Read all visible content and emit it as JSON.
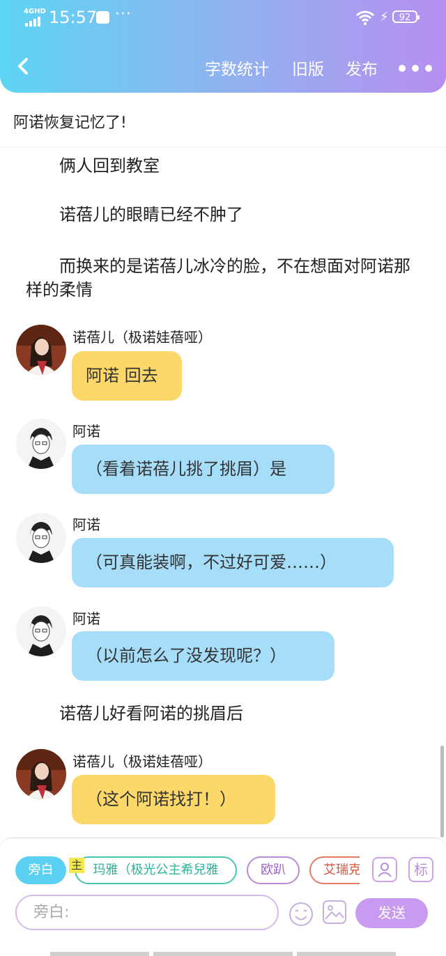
{
  "status_bar": {
    "network": "4GHD",
    "time": "15:57",
    "dots": "···",
    "battery": "92"
  },
  "header": {
    "word_count": "字数统计",
    "old_version": "旧版",
    "publish": "发布"
  },
  "doc_title": "阿诺恢复记忆了!",
  "paragraphs": [
    "　　俩人回到教室",
    "　　诺蓓儿的眼睛已经不肿了",
    "　　而换来的是诺蓓儿冰冷的脸，不在想面对阿诺那样的柔情"
  ],
  "messages": [
    {
      "name": "诺蓓儿（极诺娃蓓哑）",
      "text": "阿诺 回去"
    },
    {
      "name": "阿诺",
      "text": "（看着诺蓓儿挑了挑眉）是"
    },
    {
      "name": "阿诺",
      "text": "（可真能装啊，不过好可爱……）"
    },
    {
      "name": "阿诺",
      "text": "（以前怎么了没发现呢？）"
    },
    {
      "name": "诺蓓儿（极诺娃蓓哑）",
      "text": "（这个阿诺找打！）"
    }
  ],
  "narration_2": "　　诺蓓儿好看阿诺的挑眉后",
  "composer": {
    "chips": [
      "旁白",
      "玛雅（极光公主希兒雅",
      "欧趴",
      "艾瑞克"
    ],
    "main_badge": "主",
    "tag_icon": "标",
    "input_placeholder": "旁白:",
    "send": "发送"
  },
  "colors": {
    "yellow_bubble": "#fcd86a",
    "blue_bubble": "#a6defa",
    "send": "#c89af0"
  }
}
